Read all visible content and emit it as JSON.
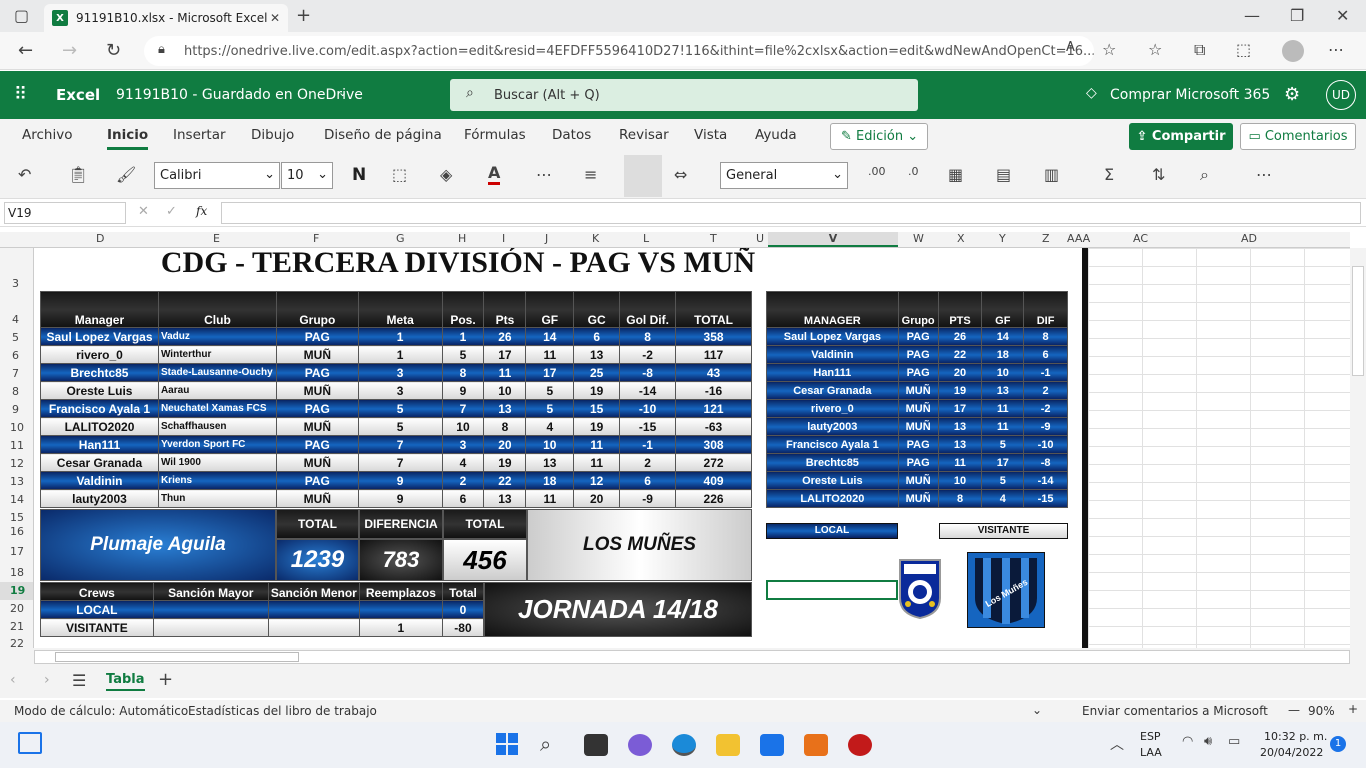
{
  "browser": {
    "tab_title": "91191B10.xlsx - Microsoft Excel C",
    "url": "https://onedrive.live.com/edit.aspx?action=edit&resid=4EFDFF5596410D27!116&ithint=file%2cxlsx&action=edit&wdNewAndOpenCt=16..."
  },
  "excel": {
    "app": "Excel",
    "doc": "91191B10  -  Guardado en OneDrive",
    "search": "Buscar (Alt + Q)",
    "buy": "Comprar Microsoft 365",
    "avatar": "UD"
  },
  "menu": [
    "Archivo",
    "Inicio",
    "Insertar",
    "Dibujo",
    "Diseño de página",
    "Fórmulas",
    "Datos",
    "Revisar",
    "Vista",
    "Ayuda"
  ],
  "edit_btn": "Edición",
  "share_btn": "Compartir",
  "comments_btn": "Comentarios",
  "toolbar": {
    "font": "Calibri",
    "size": "10",
    "bold": "N",
    "format": "General"
  },
  "namebox": "V19",
  "columns": [
    "D",
    "E",
    "F",
    "G",
    "H",
    "I",
    "J",
    "K",
    "L",
    "T",
    "U",
    "V",
    "W",
    "X",
    "Y",
    "Z",
    "AAA",
    "AC",
    "AD"
  ],
  "rows": [
    "3",
    "4",
    "5",
    "6",
    "7",
    "8",
    "9",
    "10",
    "11",
    "12",
    "13",
    "14",
    "15",
    "16",
    "17",
    "18",
    "19",
    "20",
    "21",
    "22"
  ],
  "title": "CDG - TERCERA DIVISIÓN - PAG VS MUÑ",
  "main_headers": [
    "Manager",
    "Club",
    "Grupo",
    "Meta",
    "Pos.",
    "Pts",
    "GF",
    "GC",
    "Gol Dif.",
    "TOTAL"
  ],
  "main_rows": [
    [
      "Saul Lopez Vargas",
      "Vaduz",
      "PAG",
      "1",
      "1",
      "26",
      "14",
      "6",
      "8",
      "358"
    ],
    [
      "rivero_0",
      "Winterthur",
      "MUÑ",
      "1",
      "5",
      "17",
      "11",
      "13",
      "-2",
      "117"
    ],
    [
      "Brechtc85",
      "Stade-Lausanne-Ouchy",
      "PAG",
      "3",
      "8",
      "11",
      "17",
      "25",
      "-8",
      "43"
    ],
    [
      "Oreste Luis",
      "Aarau",
      "MUÑ",
      "3",
      "9",
      "10",
      "5",
      "19",
      "-14",
      "-16"
    ],
    [
      "Francisco Ayala 1",
      "Neuchatel Xamas FCS",
      "PAG",
      "5",
      "7",
      "13",
      "5",
      "15",
      "-10",
      "121"
    ],
    [
      "LALITO2020",
      "Schaffhausen",
      "MUÑ",
      "5",
      "10",
      "8",
      "4",
      "19",
      "-15",
      "-63"
    ],
    [
      "Han111",
      "Yverdon Sport FC",
      "PAG",
      "7",
      "3",
      "20",
      "10",
      "11",
      "-1",
      "308"
    ],
    [
      "Cesar Granada",
      "Wil 1900",
      "MUÑ",
      "7",
      "4",
      "19",
      "13",
      "11",
      "2",
      "272"
    ],
    [
      "Valdinin",
      "Kriens",
      "PAG",
      "9",
      "2",
      "22",
      "18",
      "12",
      "6",
      "409"
    ],
    [
      "lauty2003",
      "Thun",
      "MUÑ",
      "9",
      "6",
      "13",
      "11",
      "20",
      "-9",
      "226"
    ]
  ],
  "summary": {
    "team1": "Plumaje Aguila",
    "total_label": "TOTAL",
    "diff_label": "DIFERENCIA",
    "total1": "1239",
    "diff": "783",
    "total2": "456",
    "team2": "LOS MUÑES"
  },
  "crews_headers": [
    "Crews",
    "Sanción Mayor",
    "Sanción Menor",
    "Reemplazos",
    "Total"
  ],
  "crews_rows": [
    [
      "LOCAL",
      "",
      "",
      "",
      "0"
    ],
    [
      "VISITANTE",
      "",
      "",
      "1",
      "-80"
    ]
  ],
  "jornada": "JORNADA 14/18",
  "rank_headers": [
    "MANAGER",
    "Grupo",
    "PTS",
    "GF",
    "DIF"
  ],
  "rank_rows": [
    [
      "Saul Lopez Vargas",
      "PAG",
      "26",
      "14",
      "8"
    ],
    [
      "Valdinin",
      "PAG",
      "22",
      "18",
      "6"
    ],
    [
      "Han111",
      "PAG",
      "20",
      "10",
      "-1"
    ],
    [
      "Cesar Granada",
      "MUÑ",
      "19",
      "13",
      "2"
    ],
    [
      "rivero_0",
      "MUÑ",
      "17",
      "11",
      "-2"
    ],
    [
      "lauty2003",
      "MUÑ",
      "13",
      "11",
      "-9"
    ],
    [
      "Francisco Ayala 1",
      "PAG",
      "13",
      "5",
      "-10"
    ],
    [
      "Brechtc85",
      "PAG",
      "11",
      "17",
      "-8"
    ],
    [
      "Oreste Luis",
      "MUÑ",
      "10",
      "5",
      "-14"
    ],
    [
      "LALITO2020",
      "MUÑ",
      "8",
      "4",
      "-15"
    ]
  ],
  "local_label": "LOCAL",
  "visitante_label": "VISITANTE",
  "logo2_text": "Los Muñes",
  "sheet_tab": "Tabla",
  "status": {
    "calc": "Modo de cálculo: Automático",
    "stats": "Estadísticas del libro de trabajo",
    "feedback": "Enviar comentarios a Microsoft",
    "zoom": "90%"
  },
  "clock": {
    "lang1": "ESP",
    "lang2": "LAA",
    "time": "10:32 p. m.",
    "date": "20/04/2022",
    "badge": "1"
  }
}
